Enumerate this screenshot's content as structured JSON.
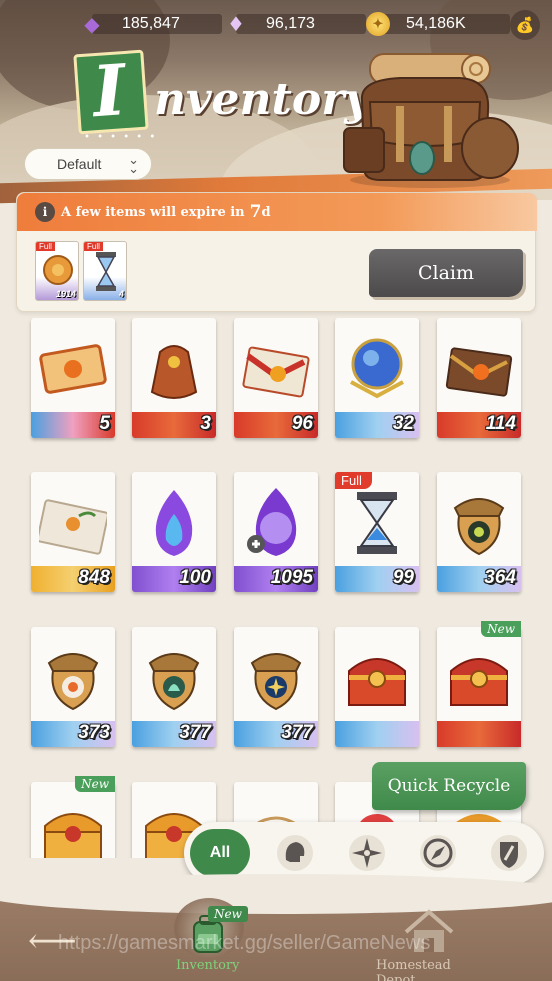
{
  "currency": {
    "gem": "185,847",
    "diamond": "96,173",
    "coin": "54,186K"
  },
  "title": {
    "first_letter": "I",
    "rest": "nventory"
  },
  "sort": {
    "selected": "Default"
  },
  "expire": {
    "message": "A few items will expire in",
    "days": "7",
    "unit": "d",
    "items": [
      {
        "badge": "Full",
        "count": "1914"
      },
      {
        "badge": "Full",
        "count": "4"
      }
    ],
    "claim_label": "Claim"
  },
  "items": [
    {
      "qty": "5"
    },
    {
      "qty": "3"
    },
    {
      "qty": "96"
    },
    {
      "qty": "32"
    },
    {
      "qty": "114"
    },
    {
      "qty": "848"
    },
    {
      "qty": "100"
    },
    {
      "qty": "1095"
    },
    {
      "qty": "99",
      "badge": "Full",
      "peek": "h"
    },
    {
      "qty": "364"
    },
    {
      "qty": "373"
    },
    {
      "qty": "377"
    },
    {
      "qty": "377"
    },
    {
      "qty": ""
    },
    {
      "qty": "",
      "badge": "New"
    },
    {
      "qty": "",
      "badge": "New"
    },
    {
      "qty": ""
    },
    {
      "qty": ""
    },
    {
      "qty": ""
    },
    {
      "qty": ""
    }
  ],
  "quick_recycle_label": "Quick Recycle",
  "filters": {
    "all_label": "All"
  },
  "nav": {
    "inventory_label": "Inventory",
    "inventory_badge": "New",
    "depot_label": "Homestead Depot"
  },
  "watermark": "https://gamesmarket.gg/seller/GameNews",
  "colors": {
    "accent_green": "#3f8a4a",
    "expire_orange": "#ef7d3c",
    "full_red": "#e03b2b"
  }
}
